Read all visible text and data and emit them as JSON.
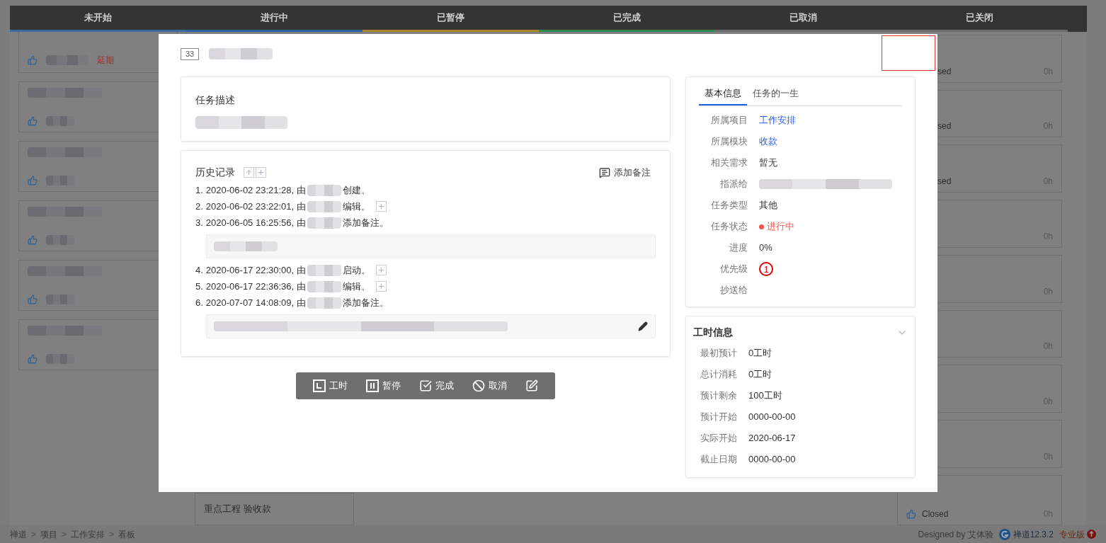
{
  "board": {
    "columns": [
      {
        "title": "未开始",
        "color": "#3b6a9e"
      },
      {
        "title": "进行中",
        "color": "#2c62a0"
      },
      {
        "title": "已暂停",
        "color": "#a7862c"
      },
      {
        "title": "已完成",
        "color": "#2f8a4f"
      },
      {
        "title": "已取消",
        "color": "#6b6b6b"
      },
      {
        "title": "已关闭",
        "color": "#6b6b6b"
      }
    ],
    "left_cards": [
      {
        "kind": "delayed",
        "tag": "延期"
      },
      {
        "kind": "plain"
      },
      {
        "kind": "plain"
      },
      {
        "kind": "plain"
      },
      {
        "kind": "plain"
      },
      {
        "kind": "plain"
      }
    ],
    "bottom_card": {
      "title": "重点工程 验收款"
    },
    "right_cards": [
      {
        "kind": "clipped",
        "status": "sed",
        "hours": "0h"
      },
      {
        "kind": "clipped",
        "status": "sed",
        "hours": "0h"
      },
      {
        "kind": "clipped",
        "status": "sed",
        "hours": "0h"
      },
      {
        "kind": "clipped",
        "hours": "0h"
      },
      {
        "kind": "clipped",
        "hours": "0h"
      },
      {
        "kind": "clipped",
        "hours": "0h"
      },
      {
        "kind": "clipped",
        "hours": "0h"
      },
      {
        "kind": "clipped",
        "hours": "0h"
      },
      {
        "kind": "full",
        "status": "Closed",
        "hours": "0h"
      }
    ]
  },
  "modal": {
    "id": "33",
    "description": {
      "title": "任务描述"
    },
    "history": {
      "title": "历史记录",
      "add_note": "添加备注",
      "entries": [
        {
          "number": "1.",
          "time": "2020-06-02 23:21:28, 由",
          "action": "创建。",
          "expandable": false,
          "has_note": false
        },
        {
          "number": "2.",
          "time": "2020-06-02 23:22:01, 由",
          "action": "编辑。",
          "expandable": true,
          "has_note": false
        },
        {
          "number": "3.",
          "time": "2020-06-05 16:25:56, 由",
          "action": "添加备注。",
          "expandable": false,
          "has_note": true
        },
        {
          "number": "4.",
          "time": "2020-06-17 22:30:00, 由",
          "action": "启动。",
          "expandable": true,
          "has_note": false
        },
        {
          "number": "5.",
          "time": "2020-06-17 22:36:36, 由",
          "action": "编辑。",
          "expandable": true,
          "has_note": false
        },
        {
          "number": "6.",
          "time": "2020-07-07 14:08:09, 由",
          "action": "添加备注。",
          "expandable": false,
          "has_note": true,
          "editable": true
        }
      ]
    },
    "actions": [
      {
        "kind": "timesheet",
        "label": "工时"
      },
      {
        "kind": "pause",
        "label": "暂停"
      },
      {
        "kind": "finish",
        "label": "完成"
      },
      {
        "kind": "cancel",
        "label": "取消"
      },
      {
        "kind": "edit"
      }
    ],
    "info": {
      "tabs": [
        {
          "label": "基本信息",
          "selected": true
        },
        {
          "label": "任务的一生",
          "selected": false
        }
      ],
      "fields": [
        {
          "label": "所属项目",
          "kind": "link",
          "value": "工作安排"
        },
        {
          "label": "所属模块",
          "kind": "link",
          "value": "收款"
        },
        {
          "label": "相关需求",
          "kind": "text",
          "value": "暂无"
        },
        {
          "label": "指派给",
          "kind": "hidden"
        },
        {
          "label": "任务类型",
          "kind": "text",
          "value": "其他"
        },
        {
          "label": "任务状态",
          "kind": "status",
          "value": "进行中"
        },
        {
          "label": "进度",
          "kind": "text",
          "value": "0%"
        },
        {
          "label": "优先级",
          "kind": "priority",
          "value": "1"
        },
        {
          "label": "抄送给",
          "kind": "empty"
        }
      ]
    },
    "hours": {
      "title": "工时信息",
      "rows": [
        {
          "label": "最初预计",
          "value": "0工时"
        },
        {
          "label": "总计消耗",
          "value": "0工时"
        },
        {
          "label": "预计剩余",
          "value": "100工时"
        },
        {
          "label": "预计开始",
          "value": "0000-00-00"
        },
        {
          "label": "实际开始",
          "value": "2020-06-17"
        },
        {
          "label": "截止日期",
          "value": "0000-00-00"
        }
      ]
    }
  },
  "footer": {
    "breadcrumb": [
      "禅道",
      "项目",
      "工作安排",
      "看板"
    ],
    "separator": ">",
    "designed_by": "Designed by 艾体验",
    "version": "禅道12.3.2",
    "edition": "专业版"
  }
}
